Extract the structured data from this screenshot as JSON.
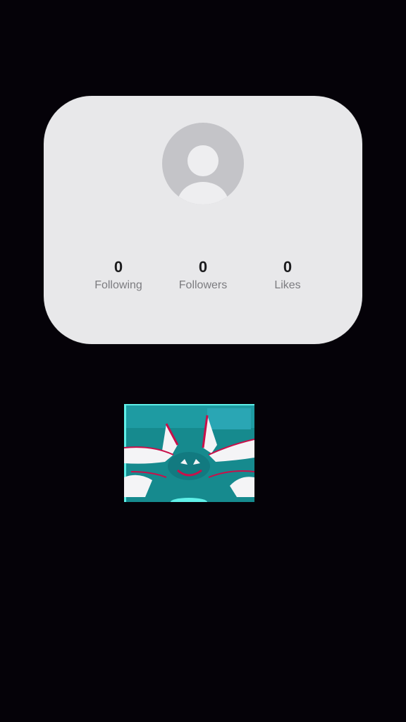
{
  "profile": {
    "avatar_icon": "default-avatar-icon",
    "stats": [
      {
        "value": "0",
        "label": "Following"
      },
      {
        "value": "0",
        "label": "Followers"
      },
      {
        "value": "0",
        "label": "Likes"
      }
    ]
  },
  "colors": {
    "background": "#050208",
    "card": "#e8e8ea",
    "avatar_bg": "#c4c4c8",
    "stat_value": "#1c1c1e",
    "stat_label": "#7c7c80",
    "thumb_teal": "#1a8e92",
    "thumb_accent": "#c8104a"
  }
}
